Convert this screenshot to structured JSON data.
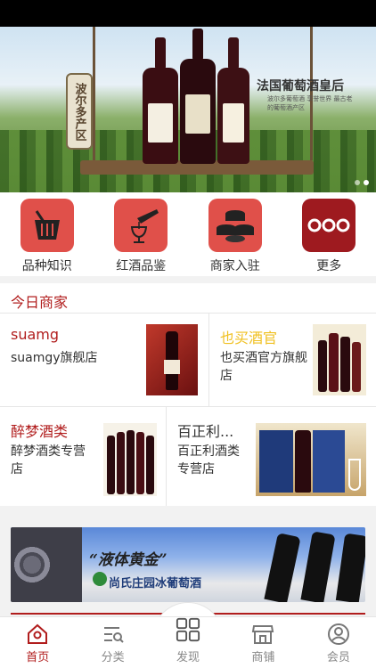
{
  "banner": {
    "sign_text": "波尔多产区",
    "title": "法国葡萄酒皇后",
    "subtitle": "波尔多葡萄酒 享誉世界 最古老的葡萄酒产区"
  },
  "quick_menu": [
    {
      "label": "品种知识",
      "icon": "wine-bucket-icon"
    },
    {
      "label": "红酒品鉴",
      "icon": "wine-pour-icon"
    },
    {
      "label": "商家入驻",
      "icon": "stacked-coins-icon"
    },
    {
      "label": "更多",
      "icon": "more-icon"
    }
  ],
  "section": {
    "title": "今日商家"
  },
  "merchants": [
    {
      "name": "suamg",
      "desc": "suamgy旗舰店",
      "color": "#b11d1d"
    },
    {
      "name": "也买酒官",
      "desc": "也买酒官方旗舰店",
      "color": "#f0c020"
    },
    {
      "name": "醉梦酒类",
      "desc": "醉梦酒类专营店",
      "color": "#b11d1d"
    },
    {
      "name": "百正利...",
      "desc": "百正利酒类专营店",
      "color": "#333333"
    }
  ],
  "ad": {
    "slogan": "“液体黄金”",
    "brand": "尚氏庄园冰葡萄酒"
  },
  "tabbar": [
    {
      "label": "首页",
      "icon": "home-icon",
      "active": true
    },
    {
      "label": "分类",
      "icon": "category-icon",
      "active": false
    },
    {
      "label": "发现",
      "icon": "discover-grid-icon",
      "active": false
    },
    {
      "label": "商铺",
      "icon": "shop-icon",
      "active": false
    },
    {
      "label": "会员",
      "icon": "member-icon",
      "active": false
    }
  ],
  "colors": {
    "accent": "#b11d1d",
    "icon_red": "#e0504a"
  }
}
